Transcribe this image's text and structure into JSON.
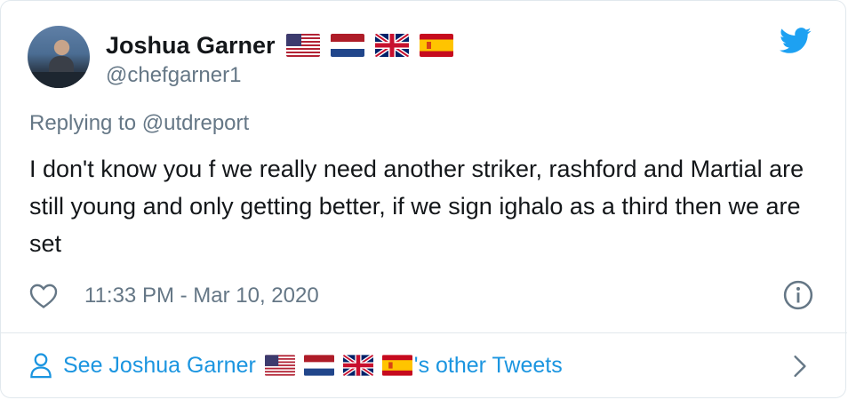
{
  "user": {
    "name": "Joshua Garner",
    "handle": "@chefgarner1",
    "flags": [
      "us-flag-icon",
      "netherlands-flag-icon",
      "uk-flag-icon",
      "spain-flag-icon"
    ]
  },
  "reply": {
    "prefix": "Replying to ",
    "mention": "@utdreport"
  },
  "tweet": {
    "text": "I don't know you f we really need another striker, rashford and Martial are still young and only getting better, if we sign ighalo as a third then we are set",
    "timestamp": "11:33 PM - Mar 10, 2020"
  },
  "footer": {
    "see_prefix": "See Joshua Garner",
    "see_suffix": "'s other Tweets"
  },
  "colors": {
    "accent": "#1da1f2",
    "link": "#1b95e0",
    "secondary_text": "#657786"
  }
}
